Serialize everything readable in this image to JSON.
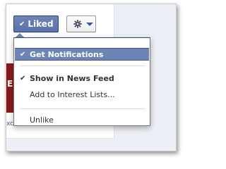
{
  "buttons": {
    "liked_label": "Liked",
    "liked_check": "✔",
    "settings_icon": "gear-icon",
    "settings_caret": "caret-down-icon"
  },
  "menu": {
    "items": [
      {
        "label": "Get Notifications",
        "checked": true,
        "highlighted": true,
        "check": "✔"
      },
      {
        "label": "Show in News Feed",
        "checked": true,
        "highlighted": false,
        "check": "✔"
      },
      {
        "label": "Add to Interest Lists...",
        "checked": false,
        "highlighted": false
      },
      {
        "label": "Unlike",
        "checked": false,
        "highlighted": false
      }
    ]
  },
  "background": {
    "cover_glyph": "E",
    "cut_text": "xc"
  },
  "colors": {
    "brand_blue": "#3b5998",
    "button_blue": "#6d84b4",
    "page_bg": "#eceff5"
  }
}
